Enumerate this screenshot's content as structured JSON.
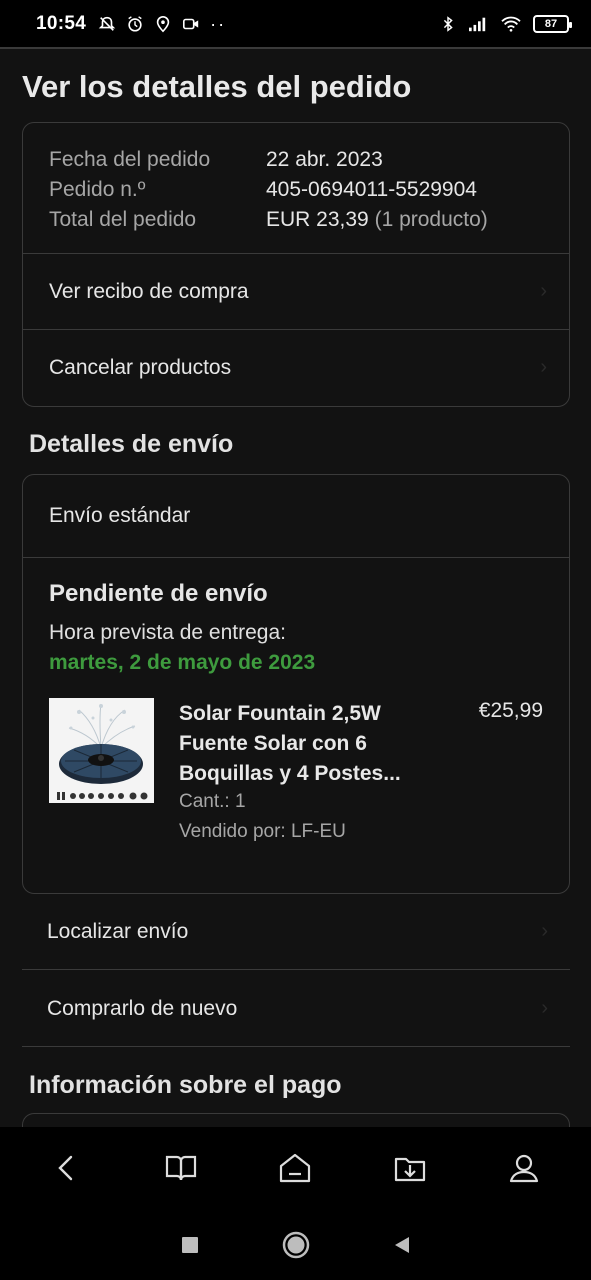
{
  "status_bar": {
    "time": "10:54",
    "battery": "87",
    "left_icons": [
      "mute-notifications-icon",
      "alarm-icon",
      "location-icon",
      "video-icon",
      "more-dots-icon"
    ],
    "right_icons": [
      "bluetooth-icon",
      "signal-icon",
      "wifi-icon",
      "battery-icon"
    ]
  },
  "page": {
    "title": "Ver los detalles del pedido"
  },
  "order_summary": {
    "rows": [
      {
        "label": "Fecha del pedido",
        "value": "22 abr. 2023"
      },
      {
        "label": "Pedido n.º",
        "value": "405-0694011-5529904"
      }
    ],
    "total_label": "Total del pedido",
    "total_value": "EUR 23,39",
    "total_items": "(1 producto)",
    "links": [
      "Ver recibo de compra",
      "Cancelar productos"
    ]
  },
  "shipping": {
    "section_title": "Detalles de envío",
    "method": "Envío estándar",
    "status": "Pendiente de envío",
    "eta_label": "Hora prevista de entrega:",
    "eta_date": "martes, 2 de mayo de 2023",
    "eta_color": "#3e9b3e",
    "product": {
      "name": "Solar Fountain 2,5W Fuente Solar con 6 Boquillas y 4 Postes...",
      "price": "€25,99",
      "quantity": "Cant.: 1",
      "seller": "Vendido por: LF-EU"
    },
    "actions": [
      "Localizar envío",
      "Comprarlo de nuevo"
    ]
  },
  "payment": {
    "section_title": "Información sobre el pago"
  },
  "app_nav": [
    "back-icon",
    "book-icon",
    "home-icon",
    "download-icon",
    "account-icon"
  ],
  "system_nav": [
    "recents-square-icon",
    "home-circle-icon",
    "back-triangle-icon"
  ]
}
